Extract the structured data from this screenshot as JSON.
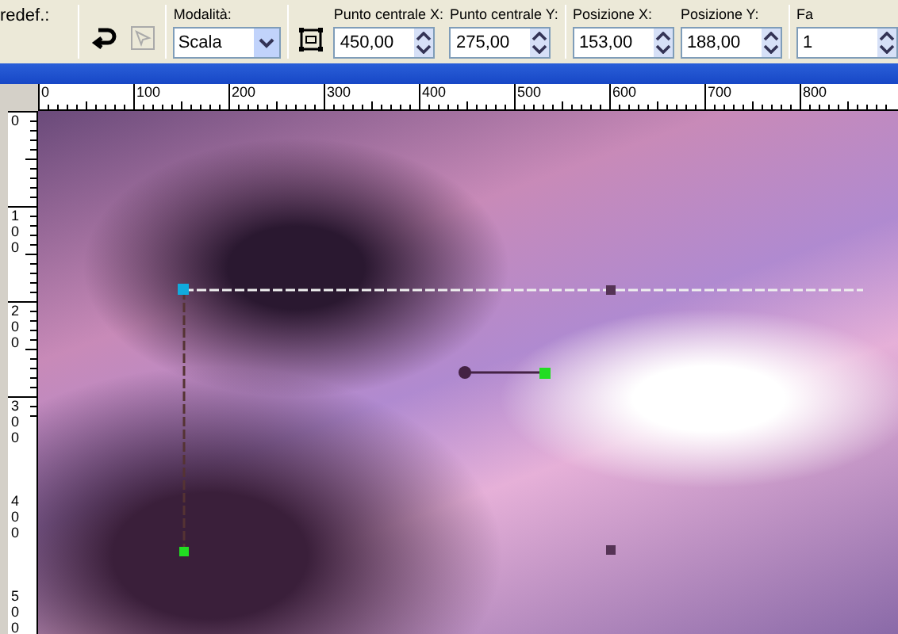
{
  "toolbar": {
    "preset_label": "redef.:",
    "mode": {
      "label": "Modalità:",
      "value": "Scala"
    },
    "fields": [
      {
        "label": "Punto centrale X:",
        "value": "450,00"
      },
      {
        "label": "Punto centrale Y:",
        "value": "275,00"
      },
      {
        "label": "Posizione X:",
        "value": "153,00"
      },
      {
        "label": "Posizione Y:",
        "value": "188,00"
      },
      {
        "label": "Fa",
        "value": "1"
      }
    ]
  },
  "rulers": {
    "horizontal": [
      "0",
      "100",
      "200",
      "300",
      "400",
      "500",
      "600",
      "700",
      "800"
    ],
    "vertical": [
      "0",
      "100",
      "200",
      "300",
      "400",
      "500"
    ]
  }
}
